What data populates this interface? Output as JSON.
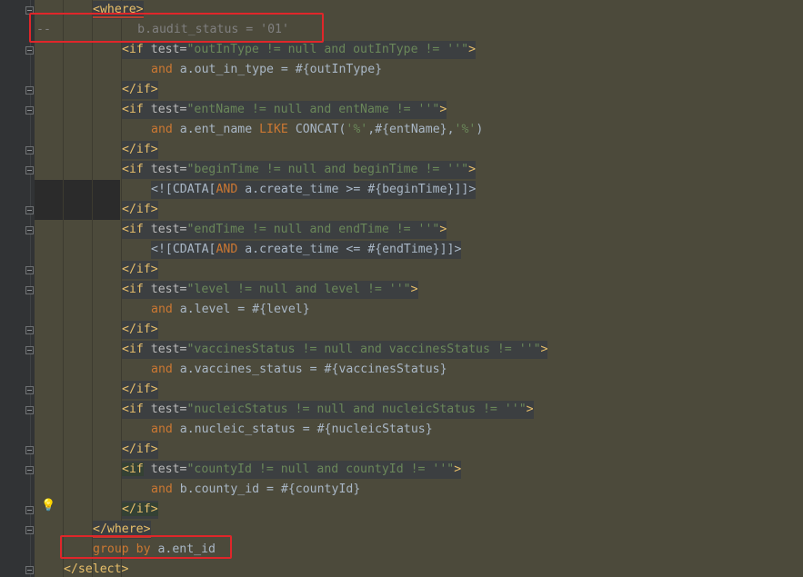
{
  "editor": {
    "lines": [
      {
        "id": "where-open",
        "parts": [
          {
            "c": "tag",
            "t": "<where>"
          }
        ]
      },
      {
        "id": "commented-audit",
        "parts": [
          {
            "c": "cmt",
            "t": "--"
          },
          {
            "c": "cmt",
            "t": "            b.audit_status = '01'"
          }
        ]
      },
      {
        "id": "if-outintype-open",
        "parts": [
          {
            "c": "tag",
            "t": "<if "
          },
          {
            "c": "attr",
            "t": "test="
          },
          {
            "c": "str",
            "t": "\"outInType != null and outInType != ''\""
          },
          {
            "c": "tag",
            "t": ">"
          }
        ]
      },
      {
        "id": "outintype-cond",
        "parts": [
          {
            "c": "kw",
            "t": "and"
          },
          {
            "c": "plain",
            "t": " a.out_in_type = #{outInType}"
          }
        ]
      },
      {
        "id": "if-outintype-close",
        "parts": [
          {
            "c": "tag",
            "t": "</if>"
          }
        ]
      },
      {
        "id": "if-entname-open",
        "parts": [
          {
            "c": "tag",
            "t": "<if "
          },
          {
            "c": "attr",
            "t": "test="
          },
          {
            "c": "str",
            "t": "\"entName != null and entName != ''\""
          },
          {
            "c": "tag",
            "t": ">"
          }
        ]
      },
      {
        "id": "entname-cond",
        "parts": [
          {
            "c": "kw",
            "t": "and"
          },
          {
            "c": "plain",
            "t": " a.ent_name "
          },
          {
            "c": "kw",
            "t": "LIKE"
          },
          {
            "c": "plain",
            "t": " CONCAT("
          },
          {
            "c": "str",
            "t": "'%'"
          },
          {
            "c": "plain",
            "t": ",#{entName},"
          },
          {
            "c": "str",
            "t": "'%'"
          },
          {
            "c": "plain",
            "t": ")"
          }
        ]
      },
      {
        "id": "if-entname-close",
        "parts": [
          {
            "c": "tag",
            "t": "</if>"
          }
        ]
      },
      {
        "id": "if-begintime-open",
        "parts": [
          {
            "c": "tag",
            "t": "<if "
          },
          {
            "c": "attr",
            "t": "test="
          },
          {
            "c": "str",
            "t": "\"beginTime != null and beginTime != ''\""
          },
          {
            "c": "tag",
            "t": ">"
          }
        ]
      },
      {
        "id": "begintime-cond",
        "parts": [
          {
            "c": "plain",
            "t": "<![CDATA["
          },
          {
            "c": "kw",
            "t": "AND"
          },
          {
            "c": "plain",
            "t": " a.create_time >= #{beginTime}]]>"
          }
        ]
      },
      {
        "id": "if-begintime-close",
        "parts": [
          {
            "c": "tag",
            "t": "</if>"
          }
        ]
      },
      {
        "id": "if-endtime-open",
        "parts": [
          {
            "c": "tag",
            "t": "<if "
          },
          {
            "c": "attr",
            "t": "test="
          },
          {
            "c": "str",
            "t": "\"endTime != null and endTime != ''\""
          },
          {
            "c": "tag",
            "t": ">"
          }
        ]
      },
      {
        "id": "endtime-cond",
        "parts": [
          {
            "c": "plain",
            "t": "<![CDATA["
          },
          {
            "c": "kw",
            "t": "AND"
          },
          {
            "c": "plain",
            "t": " a.create_time <= #{endTime}]]>"
          }
        ]
      },
      {
        "id": "if-endtime-close",
        "parts": [
          {
            "c": "tag",
            "t": "</if>"
          }
        ]
      },
      {
        "id": "if-level-open",
        "parts": [
          {
            "c": "tag",
            "t": "<if "
          },
          {
            "c": "attr",
            "t": "test="
          },
          {
            "c": "str",
            "t": "\"level != null and level != ''\""
          },
          {
            "c": "tag",
            "t": ">"
          }
        ]
      },
      {
        "id": "level-cond",
        "parts": [
          {
            "c": "kw",
            "t": "and"
          },
          {
            "c": "plain",
            "t": " a.level = #{level}"
          }
        ]
      },
      {
        "id": "if-level-close",
        "parts": [
          {
            "c": "tag",
            "t": "</if>"
          }
        ]
      },
      {
        "id": "if-vaccines-open",
        "parts": [
          {
            "c": "tag",
            "t": "<if "
          },
          {
            "c": "attr",
            "t": "test="
          },
          {
            "c": "str",
            "t": "\"vaccinesStatus != null and vaccinesStatus != ''\""
          },
          {
            "c": "tag",
            "t": ">"
          }
        ]
      },
      {
        "id": "vaccines-cond",
        "parts": [
          {
            "c": "kw",
            "t": "and"
          },
          {
            "c": "plain",
            "t": " a.vaccines_status = #{vaccinesStatus}"
          }
        ]
      },
      {
        "id": "if-vaccines-close",
        "parts": [
          {
            "c": "tag",
            "t": "</if>"
          }
        ]
      },
      {
        "id": "if-nucleic-open",
        "parts": [
          {
            "c": "tag",
            "t": "<if "
          },
          {
            "c": "attr",
            "t": "test="
          },
          {
            "c": "str",
            "t": "\"nucleicStatus != null and nucleicStatus != ''\""
          },
          {
            "c": "tag",
            "t": ">"
          }
        ]
      },
      {
        "id": "nucleic-cond",
        "parts": [
          {
            "c": "kw",
            "t": "and"
          },
          {
            "c": "plain",
            "t": " a.nucleic_status = #{nucleicStatus}"
          }
        ]
      },
      {
        "id": "if-nucleic-close",
        "parts": [
          {
            "c": "tag",
            "t": "</if>"
          }
        ]
      },
      {
        "id": "if-county-open",
        "parts": [
          {
            "c": "tag-sel",
            "t": "<if"
          },
          {
            "c": "tag",
            "t": " "
          },
          {
            "c": "attr",
            "t": "test="
          },
          {
            "c": "str",
            "t": "\"countyId != null and countyId != ''\""
          },
          {
            "c": "tag",
            "t": ">"
          }
        ]
      },
      {
        "id": "county-cond",
        "parts": [
          {
            "c": "kw",
            "t": "and"
          },
          {
            "c": "plain",
            "t": " b.county_id = #{countyId}"
          }
        ]
      },
      {
        "id": "if-county-close",
        "parts": [
          {
            "c": "tag-sel",
            "t": "</if>"
          }
        ]
      },
      {
        "id": "where-close",
        "parts": [
          {
            "c": "tag",
            "t": "</where>"
          }
        ]
      },
      {
        "id": "group-by",
        "parts": [
          {
            "c": "kw",
            "t": "group by"
          },
          {
            "c": "plain",
            "t": " a.ent_id"
          }
        ]
      },
      {
        "id": "select-close",
        "parts": [
          {
            "c": "tag",
            "t": "</select>"
          }
        ]
      }
    ]
  },
  "icons": {
    "bulb": "lightbulb-icon",
    "fold": "fold-marker-icon"
  },
  "colors": {
    "highlight_box": "#e0262a",
    "band": "#4c4a3b",
    "tag": "#e8bf6a",
    "string": "#6a8759",
    "keyword": "#cc7832"
  }
}
